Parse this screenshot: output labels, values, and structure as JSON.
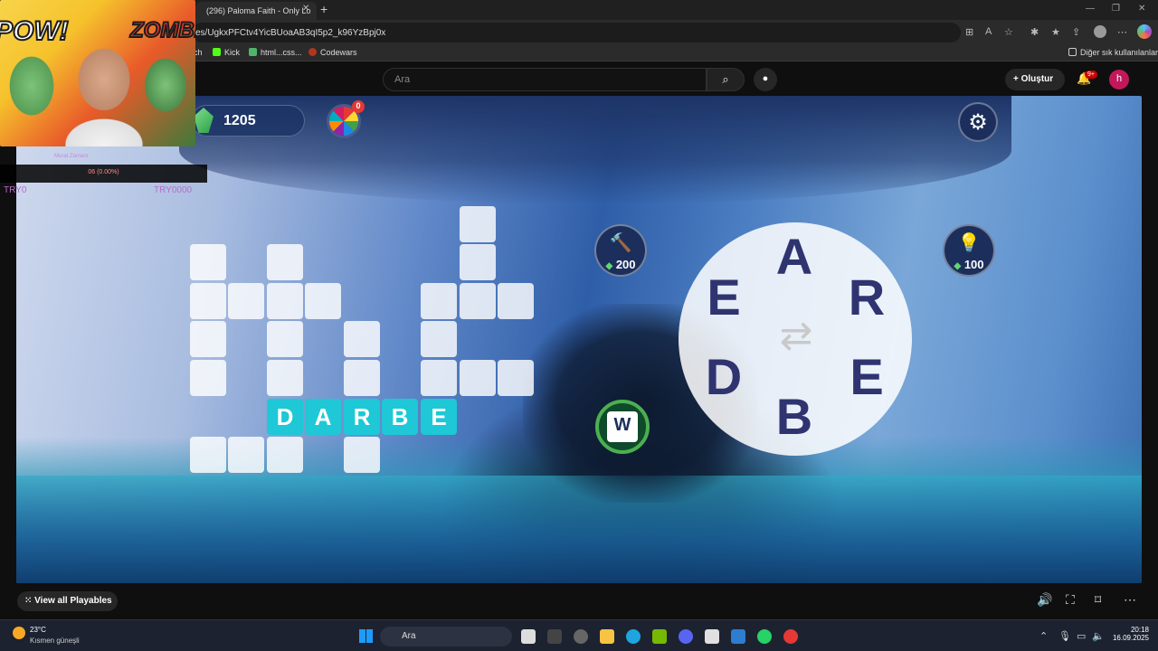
{
  "browser": {
    "tab_title": "(296) Paloma Faith - Only Lo",
    "tab_close": "✕",
    "new_tab": "+",
    "url": "es/UgkxPFCtv4YicBUoaAB3qI5p2_k96YzBpj0x",
    "bookmarks": [
      {
        "label": "ch",
        "color": "#9146ff"
      },
      {
        "label": "Kick",
        "color": "#53fc18"
      },
      {
        "label": "html...css...",
        "color": "#4fb46a"
      },
      {
        "label": "Codewars",
        "color": "#b1361e"
      }
    ],
    "other_bookmarks": "Diğer sık kullanılanlar"
  },
  "youtube": {
    "search_placeholder": "Ara",
    "create_label": "Oluştur",
    "notif_badge": "9+",
    "avatar_letter": "h",
    "view_all": "View all Playables"
  },
  "game": {
    "gems": "1205",
    "wheel_badge": "0",
    "hammer_cost": "200",
    "hint_cost": "100",
    "w_label": "W",
    "found_word": [
      "D",
      "A",
      "R",
      "B",
      "E"
    ],
    "wheel_letters": [
      "A",
      "R",
      "E",
      "B",
      "D",
      "E"
    ]
  },
  "webcam": {
    "pow": "POW!",
    "zombie": "ZOMBIE!",
    "stat": "06 (0.00%)",
    "stat_label": "Murat Zamanı",
    "left_tag": "TRY0",
    "right_tag": "TRY0000"
  },
  "taskbar": {
    "temp": "23°C",
    "weather": "Kısmen güneşli",
    "search": "Ara",
    "time": "20:18",
    "date": "16.09.2025"
  }
}
